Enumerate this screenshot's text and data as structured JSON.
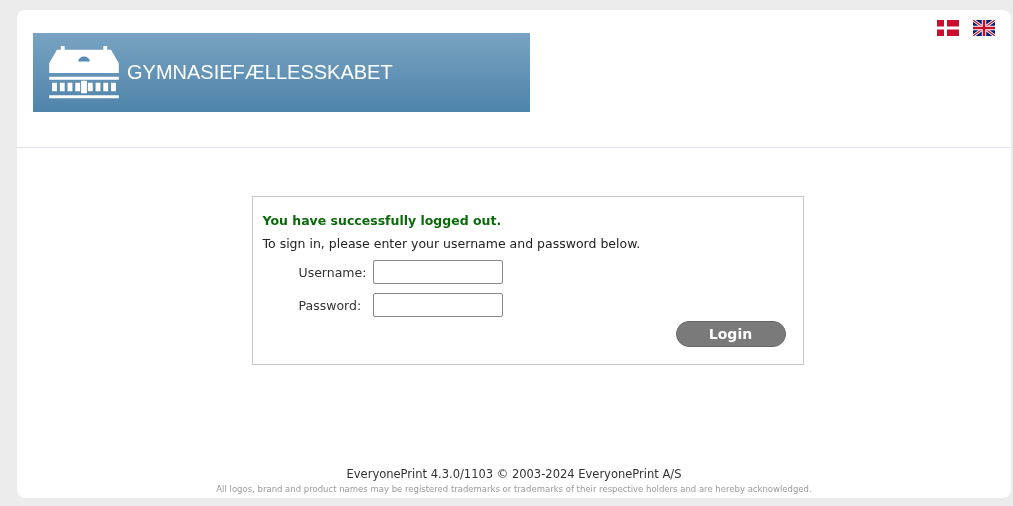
{
  "banner": {
    "title": "GYMNASIEFÆLLESSKABET"
  },
  "languages": [
    {
      "kind": "danish"
    },
    {
      "kind": "english"
    }
  ],
  "login": {
    "message": "You have successfully logged out.",
    "instructions": "To sign in, please enter your username and password below.",
    "fields": [
      {
        "label": "Username:"
      },
      {
        "label": "Password:"
      }
    ],
    "button": "Login"
  },
  "footer": {
    "version": "EveryonePrint 4.3.0/1103 © 2003-2024 EveryonePrint A/S",
    "notice": "All logos, brand and product names may be registered trademarks or trademarks of their respective holders and are hereby acknowledged."
  }
}
